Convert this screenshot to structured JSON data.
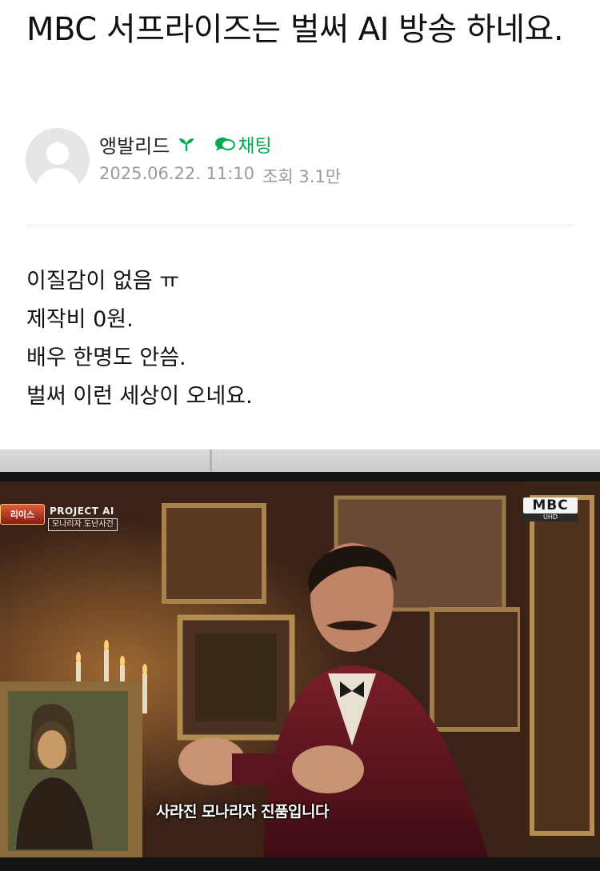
{
  "post": {
    "title": "MBC 서프라이즈는 벌써 AI 방송 하네요.",
    "author": "앵발리드",
    "chat_label": "채팅",
    "date": "2025.06.22. 11:10",
    "views": "조회 3.1만",
    "body_lines": [
      "이질감이 없음 ㅠ",
      "제작비 0원.",
      "배우 한명도 안씀.",
      "벌써 이런 세상이 오네요."
    ]
  },
  "photo": {
    "program_logo": "리이스",
    "project_title": "PROJECT AI",
    "project_subtitle": "모나리자 도난사건",
    "broadcaster": "MBC",
    "broadcaster_sub": "UHD",
    "caption": "사라진 모나리자 진품입니다"
  },
  "colors": {
    "accent_green": "#03a94d",
    "meta_gray": "#9a9a9a"
  },
  "icons": {
    "avatar": "default-avatar-icon",
    "badge": "sprout-icon",
    "chat": "chat-bubble-icon"
  }
}
